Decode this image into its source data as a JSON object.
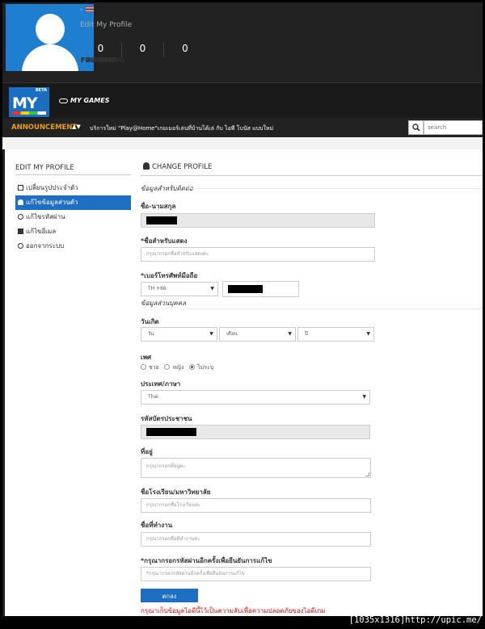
{
  "profile": {
    "username": "-",
    "edit_link": "Edit My Profile",
    "stats": [
      {
        "value": "0",
        "label": "FOLLOWS"
      },
      {
        "value": "0",
        "label": "FOLLOWING"
      },
      {
        "value": "0",
        "label": "FRIENDS"
      }
    ]
  },
  "nav": {
    "logo_beta": "BETA",
    "logo_text": "MY",
    "my_games": "MY GAMES"
  },
  "announcement": {
    "label": "ANNOUNCEMENT",
    "arrows": "▲▼",
    "text": "บริการใหม่ \"Play@Home\"เกมเมอร์เล่นที่บ้านได้เล่ กับ ไอพี โบนัส แบบใหม่",
    "search_placeholder": "search"
  },
  "sidebar": {
    "title": "EDIT MY PROFILE",
    "items": [
      {
        "label": "เปลี่ยนรูปประจำตัว",
        "icon": "image-icon",
        "active": false
      },
      {
        "label": "แก้ไขข้อมูลส่วนตัว",
        "icon": "user-icon",
        "active": true
      },
      {
        "label": "แก้ไขรหัสผ่าน",
        "icon": "key-icon",
        "active": false
      },
      {
        "label": "แก้ไขอีเมล",
        "icon": "envelope-icon",
        "active": false
      },
      {
        "label": "ออกจากระบบ",
        "icon": "key-icon",
        "active": false
      }
    ]
  },
  "form": {
    "title": "CHANGE PROFILE",
    "section_contact": "ข้อมูลสำหรับติดต่อ",
    "fullname_label": "ชื่อ-นามสกุล",
    "display_name_label": "*ชื่อสำหรับแสดง",
    "display_name_placeholder": "กรุณากรอกชื่อสำหรับแสดงค่ะ",
    "mobile_label": "*เบอร์โทรศัพท์มือถือ",
    "country_code": "TH +66",
    "section_personal": "ข้อมูลส่วนบุคคล",
    "birthday_label": "วันเกิด",
    "day": "วัน",
    "month": "เดือน",
    "year": "ปี",
    "gender_label": "เพศ",
    "gender_options": [
      "ชาย",
      "หญิง",
      "ไม่ระบุ"
    ],
    "gender_selected": "ไม่ระบุ",
    "country_label": "ประเทศ/ภาษา",
    "country_value": "Thai",
    "idcard_label": "รหัสบัตรประชาชน",
    "address_label": "ที่อยู่",
    "address_placeholder": "กรุณากรอกที่อยู่ค่ะ",
    "school_label": "ชื่อโรงเรียน/มหาวิทยาลัย",
    "school_placeholder": "กรุณากรอกชื่อโรงเรียนค่ะ",
    "work_label": "ชื่อที่ทำงาน",
    "work_placeholder": "กรุณากรอกชื่อที่ทำงานค่ะ",
    "password_label": "*กรุณากรอกรหัสผ่านอีกครั้งเพื่อยืนยันการแก้ไข",
    "password_placeholder": "*กรุณากรอกรหัสผ่านอีกครั้งเพื่อยืนยันการแก้ไข",
    "submit_label": "ตกลง",
    "note": "กรุณาเก็บข้อมูลไอดีนี้ไว้เป็นความลับเพื่อความปลอดภัยของไอดีเกม"
  },
  "watermark": "[1035x1316]http://upic.me/",
  "colors": {
    "accent": "#1e6fc1",
    "announce": "#e8a010",
    "note": "#d01010"
  }
}
